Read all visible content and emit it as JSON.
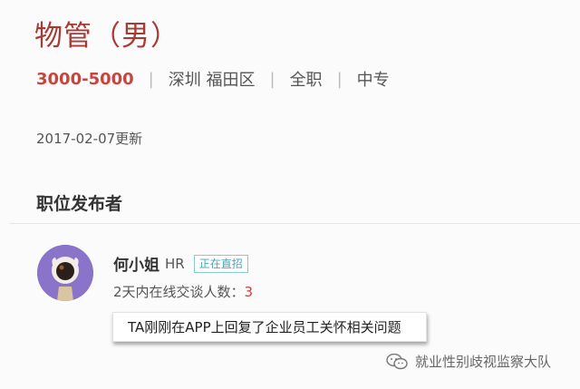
{
  "job": {
    "title": "物管（男）",
    "salary": "3000-5000",
    "separator": "|",
    "location": "深圳 福田区",
    "type": "全职",
    "education": "中专",
    "updated": "2017-02-07更新"
  },
  "publisher": {
    "section_title": "职位发布者",
    "name": "何小姐",
    "role": "HR",
    "badge": "正在直招",
    "chat_label": "2天内在线交谈人数：",
    "chat_count": "3",
    "notice": "TA刚刚在APP上回复了企业员工关怀相关问题"
  },
  "watermark": {
    "icon": "wechat-icon",
    "text": "就业性别歧视监察大队"
  },
  "colors": {
    "title": "#a83a36",
    "salary": "#c8453e",
    "badge": "#4aa6b8",
    "avatar_bg": "#8a74c9"
  }
}
